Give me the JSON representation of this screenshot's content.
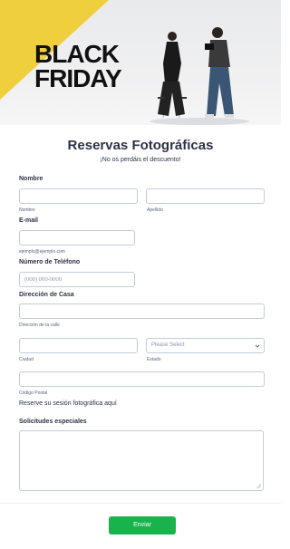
{
  "hero": {
    "line1": "BLACK",
    "line2": "FRIDAY",
    "accent_color": "#f0cf3e"
  },
  "header": {
    "title": "Reservas Fotográficas",
    "subtitle": "¡No os perdáis el descuento!"
  },
  "fields": {
    "name_label": "Nombre",
    "first_sublabel": "Nombre",
    "last_sublabel": "Apellido",
    "email_label": "E-mail",
    "email_sublabel": "ejemplo@ejemplo.com",
    "phone_label": "Número de Teléfono",
    "phone_placeholder": "(000) 000-0000",
    "address_label": "Dirección de Casa",
    "street_sublabel": "Dirección de la calle",
    "city_sublabel": "Ciudad",
    "state_sublabel": "Estado",
    "state_placeholder": "Please Select",
    "zip_sublabel": "Código Postal",
    "session_text": "Reserve su sesión fotográfica aquí",
    "requests_label": "Solicitudes especiales"
  },
  "submit": {
    "label": "Enviar",
    "color": "#18b34b"
  },
  "icons": {
    "chevron": "chevron-down-icon",
    "resize": "resize-handle-icon"
  }
}
